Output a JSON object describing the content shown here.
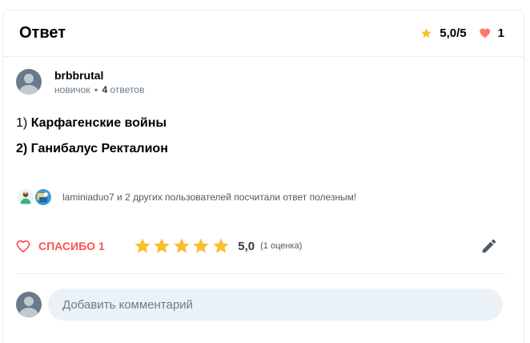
{
  "header": {
    "title": "Ответ",
    "rating": "5,0/5",
    "likes": "1"
  },
  "author": {
    "name": "brbbrutal",
    "rank": "новичок",
    "dot": "•",
    "answers_count": "4",
    "answers_label": "ответов"
  },
  "answer": {
    "line1_num": "1)",
    "line1_text": "Карфагенские войны",
    "line2_text": "2) Ганибалус Ректалион"
  },
  "thanks_note": "laminiaduo7 и 2 других пользователей посчитали ответ полезным!",
  "actions": {
    "thanks_label": "СПАСИБО 1",
    "rating_value": "5,0",
    "rating_count": "(1 оценка)",
    "stars": 5
  },
  "comment": {
    "placeholder": "Добавить комментарий"
  },
  "colors": {
    "accent_red": "#ff5050",
    "star_yellow": "#fbbe2e",
    "text_gray": "#687b8c"
  },
  "icons": [
    "star-icon",
    "heart-icon",
    "heart-outline-icon",
    "pencil-icon",
    "avatar-icon"
  ]
}
